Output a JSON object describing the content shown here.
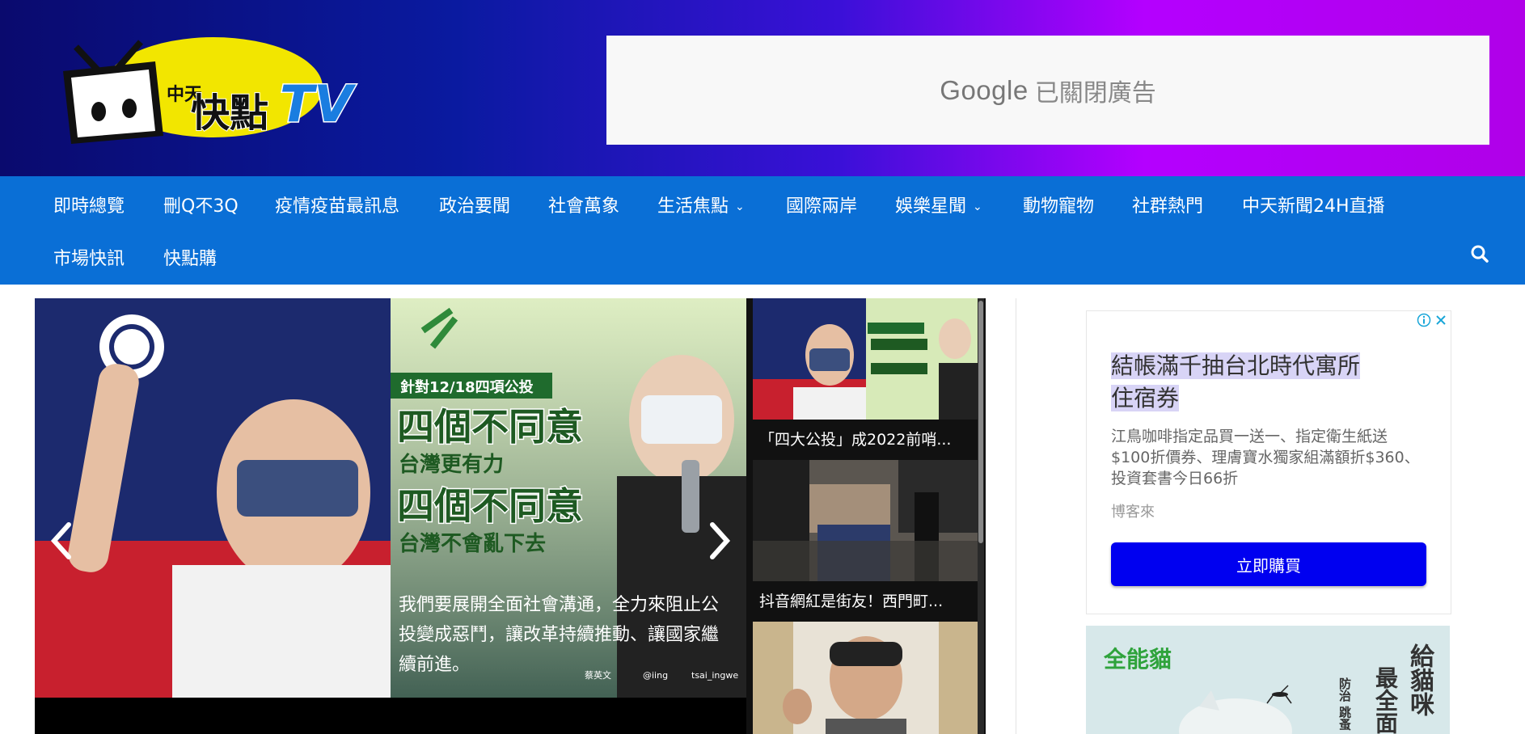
{
  "header": {
    "logo_alt": "中天快點TV",
    "logo_small": "中天",
    "logo_main": "快點",
    "logo_tv": "TV",
    "ad": {
      "brand": "Google",
      "text": "已關閉廣告"
    }
  },
  "nav": {
    "items": [
      {
        "label": "即時總覽"
      },
      {
        "label": "刪Q不3Q"
      },
      {
        "label": "疫情疫苗最訊息"
      },
      {
        "label": "政治要聞"
      },
      {
        "label": "社會萬象"
      },
      {
        "label": "生活焦點",
        "dropdown": true
      },
      {
        "label": "國際兩岸"
      },
      {
        "label": "娛樂星聞",
        "dropdown": true
      },
      {
        "label": "動物寵物"
      },
      {
        "label": "社群熱門"
      },
      {
        "label": "中天新聞24H直播"
      },
      {
        "label": "市場快訊"
      },
      {
        "label": "快點購"
      }
    ],
    "search_icon": "search-icon"
  },
  "slider": {
    "graphic": {
      "tag": "針對12/18四項公投",
      "line1": "四個不同意",
      "line2": "台灣更有力",
      "line3": "四個不同意",
      "line4": "台灣不會亂下去",
      "body1": "我們要展開全面社會溝通，全力來阻止公",
      "body2": "投變成惡鬥，讓改革持續推動、讓國家繼",
      "body3": "續前進。",
      "credit1": "蔡英文",
      "credit2": "@iing",
      "credit3": "tsai_ingwe"
    },
    "prev_icon": "chevron-left-icon",
    "next_icon": "chevron-right-icon"
  },
  "thumbs": [
    {
      "caption": "「四大公投」成2022前哨..."
    },
    {
      "caption": "抖音網紅是街友！西門町..."
    },
    {
      "caption": ""
    }
  ],
  "sidebar": {
    "ad": {
      "headline_1": "結帳滿千抽台北時代寓所",
      "headline_2": "住宿券",
      "body": "江鳥咖啡指定品買一送一、指定衛生紙送$100折價券、理膚寶水獨家組滿額折$360、投資套書今日66折",
      "advertiser": "博客來",
      "cta": "立即購買"
    },
    "ad2": {
      "brand": "全能貓",
      "col1": "給貓咪",
      "col2": "最全面",
      "col3": "防治 跳蚤"
    }
  },
  "colors": {
    "nav_bg": "#0a6fd6",
    "cta_bg": "#0000f0",
    "header_gradient_start": "#0a0a6e",
    "header_gradient_end": "#b000e8"
  }
}
